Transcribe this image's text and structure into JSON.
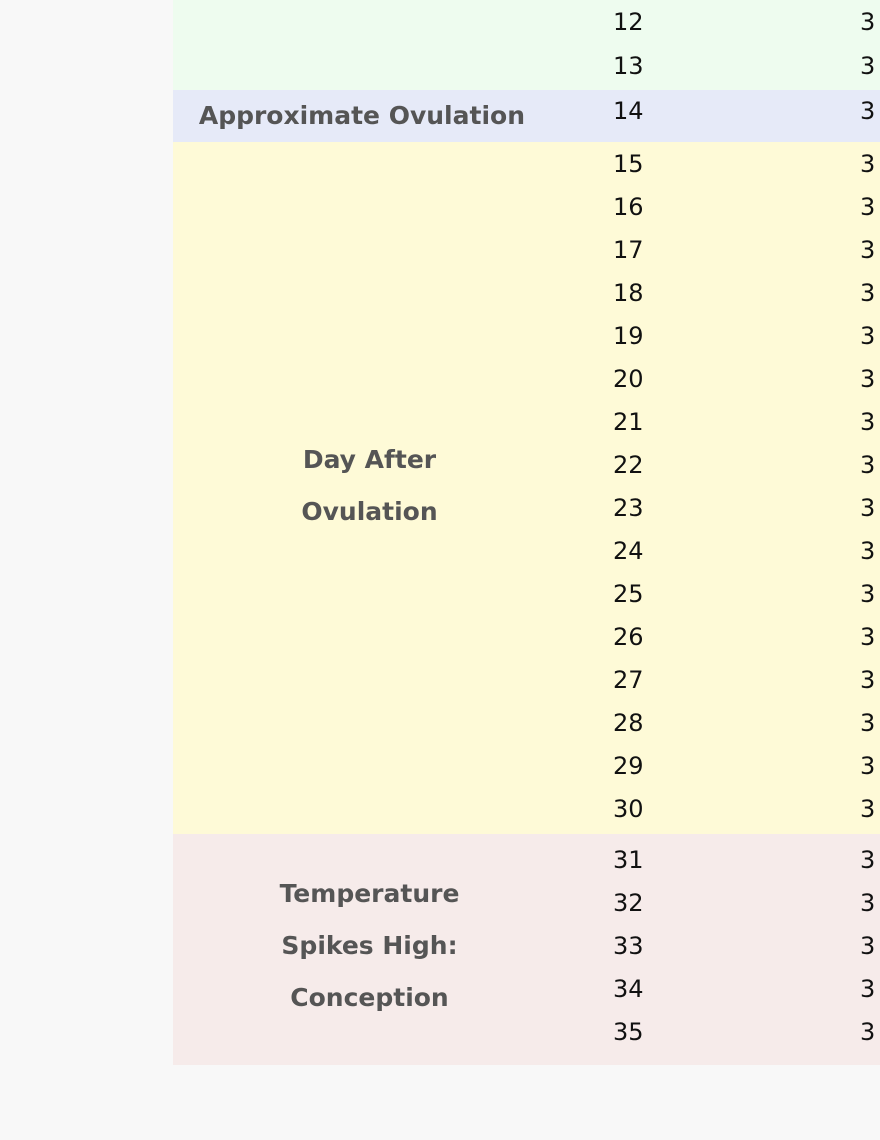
{
  "colors": {
    "page_bg": "#f8f8f8",
    "follicular": "#eefcef",
    "ovulation": "#e6eaf8",
    "luteal": "#fefad7",
    "conception": "#f6ebea"
  },
  "sections": [
    {
      "label_lines": [],
      "color": "#eefcef",
      "row_height": 44,
      "days": [
        "12",
        "13"
      ],
      "values": [
        "3",
        "3"
      ]
    },
    {
      "label_lines": [
        "Approximate Ovulation"
      ],
      "color": "#e6eaf8",
      "row_height": 42,
      "days": [
        "14"
      ],
      "values": [
        "3"
      ]
    },
    {
      "label_lines": [
        "Day After",
        "Ovulation"
      ],
      "color": "#fefad7",
      "row_height": 43,
      "days": [
        "15",
        "16",
        "17",
        "18",
        "19",
        "20",
        "21",
        "22",
        "23",
        "24",
        "25",
        "26",
        "27",
        "28",
        "29",
        "30"
      ],
      "values": [
        "3",
        "3",
        "3",
        "3",
        "3",
        "3",
        "3",
        "3",
        "3",
        "3",
        "3",
        "3",
        "3",
        "3",
        "3",
        "3"
      ]
    },
    {
      "label_lines": [
        "Temperature",
        "Spikes High:",
        "Conception"
      ],
      "color": "#f6ebea",
      "row_height": 43,
      "days": [
        "31",
        "32",
        "33",
        "34",
        "35"
      ],
      "values": [
        "3",
        "3",
        "3",
        "3",
        "3"
      ]
    }
  ]
}
